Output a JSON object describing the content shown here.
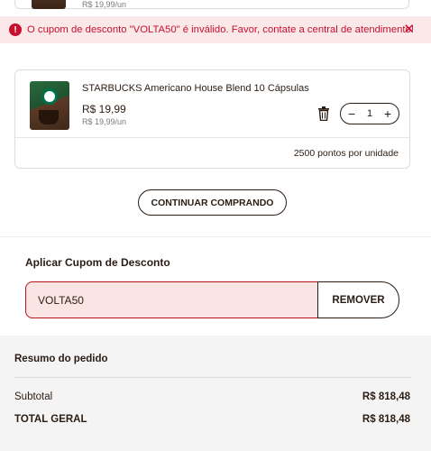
{
  "previous_item": {
    "unit_price": "R$ 19,99/un"
  },
  "alert": {
    "message": "O cupom de desconto \"VOLTA50\" é inválido. Favor, contate a central de atendimento!",
    "icon": "error-icon",
    "close_icon": "close-icon",
    "close_glyph": "✕",
    "color": "#c8102e"
  },
  "cart_item": {
    "name": "STARBUCKS Americano House Blend 10 Cápsulas",
    "price": "R$ 19,99",
    "unit_price": "R$ 19,99/un",
    "quantity": "1",
    "decrement": "−",
    "increment": "+",
    "points": "2500 pontos por unidade"
  },
  "continue_button": "CONTINUAR COMPRANDO",
  "coupon": {
    "title": "Aplicar Cupom de Desconto",
    "value": "VOLTA50",
    "remove_label": "REMOVER",
    "error_color": "#b5121b"
  },
  "summary": {
    "title": "Resumo do pedido",
    "subtotal_label": "Subtotal",
    "subtotal_value": "R$ 818,48",
    "total_label": "TOTAL GERAL",
    "total_value": "R$ 818,48"
  }
}
